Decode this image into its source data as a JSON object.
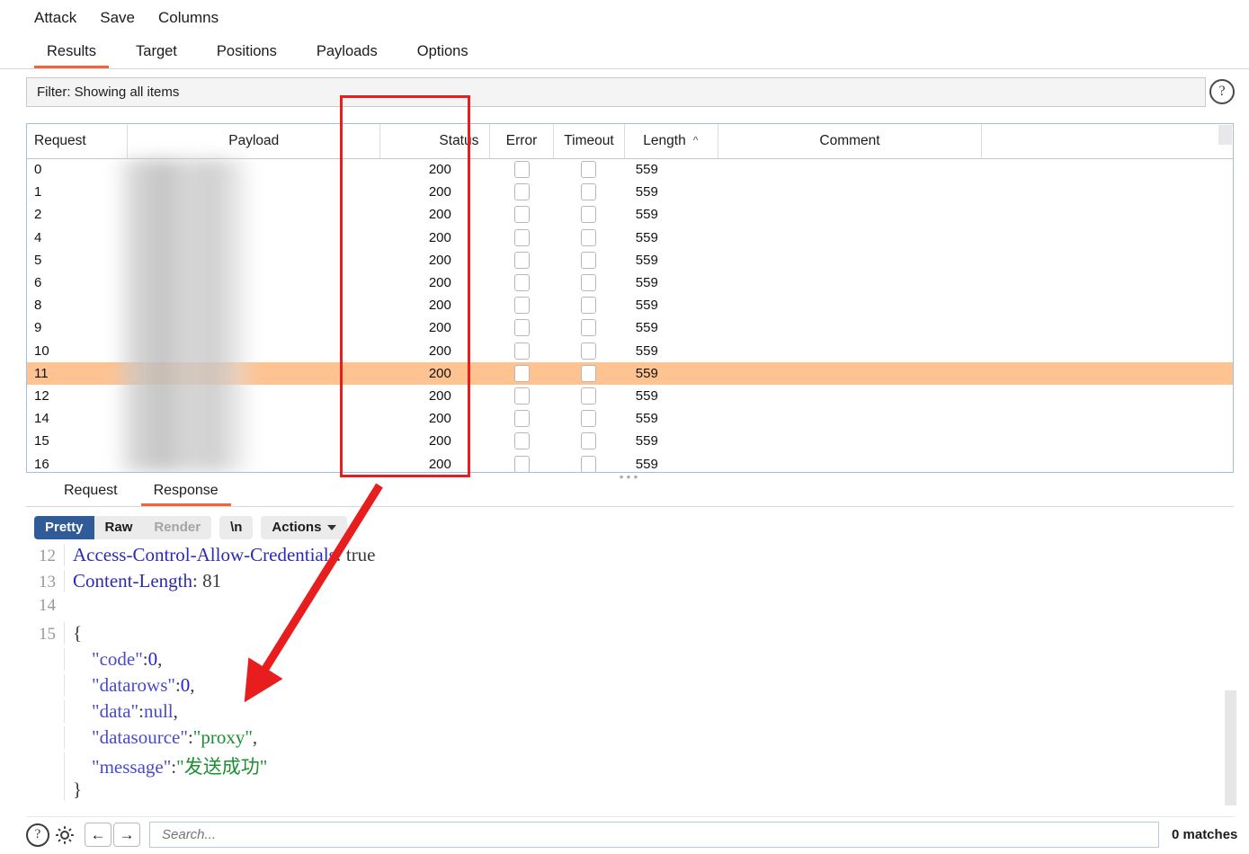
{
  "menubar": {
    "items": [
      "Attack",
      "Save",
      "Columns"
    ]
  },
  "tabs": {
    "items": [
      {
        "label": "Results",
        "active": true
      },
      {
        "label": "Target",
        "active": false
      },
      {
        "label": "Positions",
        "active": false
      },
      {
        "label": "Payloads",
        "active": false
      },
      {
        "label": "Options",
        "active": false
      }
    ]
  },
  "filter": {
    "text": "Filter: Showing all items",
    "help_icon": "question-mark-icon"
  },
  "table": {
    "columns": [
      "Request",
      "Payload",
      "Status",
      "Error",
      "Timeout",
      "Length",
      "Comment",
      ""
    ],
    "sorted_column": "Length",
    "sort_direction": "^",
    "rows": [
      {
        "request": "0",
        "payload": "",
        "status": "200",
        "length": "559",
        "comment": "",
        "selected": false
      },
      {
        "request": "1",
        "payload": "",
        "status": "200",
        "length": "559",
        "comment": "",
        "selected": false
      },
      {
        "request": "2",
        "payload": "",
        "status": "200",
        "length": "559",
        "comment": "",
        "selected": false
      },
      {
        "request": "4",
        "payload": "",
        "status": "200",
        "length": "559",
        "comment": "",
        "selected": false
      },
      {
        "request": "5",
        "payload": "",
        "status": "200",
        "length": "559",
        "comment": "",
        "selected": false
      },
      {
        "request": "6",
        "payload": "",
        "status": "200",
        "length": "559",
        "comment": "",
        "selected": false
      },
      {
        "request": "8",
        "payload": "",
        "status": "200",
        "length": "559",
        "comment": "",
        "selected": false
      },
      {
        "request": "9",
        "payload": "",
        "status": "200",
        "length": "559",
        "comment": "",
        "selected": false
      },
      {
        "request": "10",
        "payload": "",
        "status": "200",
        "length": "559",
        "comment": "",
        "selected": false
      },
      {
        "request": "11",
        "payload": "",
        "status": "200",
        "length": "559",
        "comment": "",
        "selected": true
      },
      {
        "request": "12",
        "payload": "",
        "status": "200",
        "length": "559",
        "comment": "",
        "selected": false
      },
      {
        "request": "14",
        "payload": "",
        "status": "200",
        "length": "559",
        "comment": "",
        "selected": false
      },
      {
        "request": "15",
        "payload": "",
        "status": "200",
        "length": "559",
        "comment": "",
        "selected": false
      },
      {
        "request": "16",
        "payload": "",
        "status": "200",
        "length": "559",
        "comment": "",
        "selected": false
      }
    ],
    "selected_row_color": "#fec391"
  },
  "message_tabs": {
    "items": [
      {
        "label": "Request",
        "active": false
      },
      {
        "label": "Response",
        "active": true
      }
    ]
  },
  "viewbar": {
    "pretty": "Pretty",
    "raw": "Raw",
    "render": "Render",
    "newline": "\\n",
    "actions": "Actions",
    "active": "Pretty"
  },
  "response": {
    "lines": [
      {
        "no": "12",
        "segments": [
          {
            "t": "Access-Control-Allow-Credentials",
            "c": "header"
          },
          {
            "t": ": ",
            "c": "plain"
          },
          {
            "t": "true",
            "c": "plain"
          }
        ]
      },
      {
        "no": "13",
        "segments": [
          {
            "t": "Content-Length",
            "c": "header"
          },
          {
            "t": ": ",
            "c": "plain"
          },
          {
            "t": "81",
            "c": "plain"
          }
        ]
      },
      {
        "no": "14",
        "segments": []
      },
      {
        "no": "15",
        "segments": [
          {
            "t": "{",
            "c": "plain"
          }
        ]
      },
      {
        "no": "",
        "segments": [
          {
            "t": "    \"code\"",
            "c": "key"
          },
          {
            "t": ":",
            "c": "plain"
          },
          {
            "t": "0",
            "c": "num"
          },
          {
            "t": ",",
            "c": "plain"
          }
        ]
      },
      {
        "no": "",
        "segments": [
          {
            "t": "    \"datarows\"",
            "c": "key"
          },
          {
            "t": ":",
            "c": "plain"
          },
          {
            "t": "0",
            "c": "num"
          },
          {
            "t": ",",
            "c": "plain"
          }
        ]
      },
      {
        "no": "",
        "segments": [
          {
            "t": "    \"data\"",
            "c": "key"
          },
          {
            "t": ":",
            "c": "plain"
          },
          {
            "t": "null",
            "c": "key"
          },
          {
            "t": ",",
            "c": "plain"
          }
        ]
      },
      {
        "no": "",
        "segments": [
          {
            "t": "    \"datasource\"",
            "c": "key"
          },
          {
            "t": ":",
            "c": "plain"
          },
          {
            "t": "\"proxy\"",
            "c": "str"
          },
          {
            "t": ",",
            "c": "plain"
          }
        ]
      },
      {
        "no": "",
        "segments": [
          {
            "t": "    \"message\"",
            "c": "key"
          },
          {
            "t": ":",
            "c": "plain"
          },
          {
            "t": "\"发送成功\"",
            "c": "str"
          }
        ]
      },
      {
        "no": "",
        "segments": [
          {
            "t": "}",
            "c": "plain"
          }
        ]
      }
    ]
  },
  "bottom": {
    "help_icon": "question-mark-icon",
    "settings_icon": "gear-icon",
    "back_icon": "arrow-left-icon",
    "forward_icon": "arrow-right-icon",
    "search_placeholder": "Search...",
    "search_value": "",
    "matches": "0 matches"
  },
  "annotations": {
    "highlight_color": "#e81d1d",
    "rect_target": "Status column",
    "arrow_target": "datarows value"
  }
}
